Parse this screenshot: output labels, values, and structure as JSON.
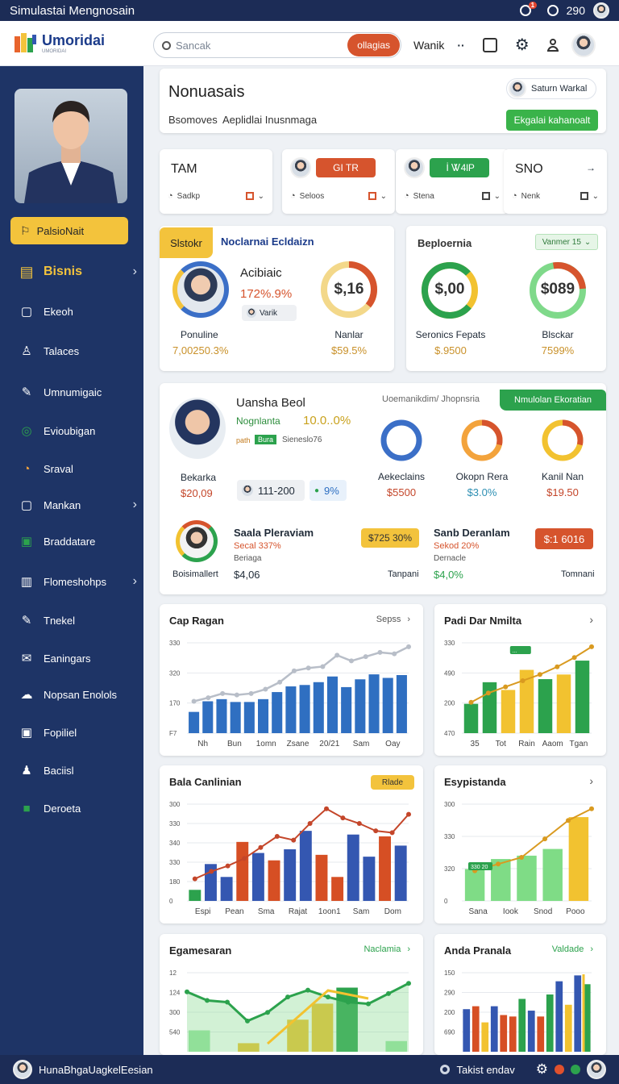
{
  "system": {
    "title": "Simulastai Mengnosain",
    "badge": "1",
    "time": "290"
  },
  "nav": {
    "brand": "Umoridai",
    "brand_sub": "UMORIDAI",
    "search_placeholder": "Sancak",
    "search_button": "ollagias",
    "user_menu": "Wanik",
    "more": "··"
  },
  "sidebar": {
    "primary_button": "PalsioNait",
    "items": [
      {
        "label": "Bisnis",
        "active": true,
        "chevron": "›"
      },
      {
        "label": "Ekeoh"
      },
      {
        "label": "Talaces"
      },
      {
        "label": "Umnumigaic"
      },
      {
        "label": "Evioubigan"
      },
      {
        "label": "Sraval"
      },
      {
        "label": "Mankan",
        "chevron": "›"
      },
      {
        "label": "Braddatare"
      },
      {
        "label": "Flomeshohps",
        "chevron": "›"
      },
      {
        "label": "Tnekel"
      },
      {
        "label": "Eaningars"
      },
      {
        "label": "Nopsan Enolols"
      },
      {
        "label": "Fopiliel"
      },
      {
        "label": "Baciisl"
      },
      {
        "label": "Deroeta"
      }
    ]
  },
  "header": {
    "title": "Nonuasais",
    "tab1": "Bsomoves",
    "tab2": "Aeplidlai Inusnmaga",
    "user_label": "Saturn Warkal",
    "action": "Ekgalai kahanoalt"
  },
  "filters": [
    {
      "title": "TAM",
      "field": "Sadkp"
    },
    {
      "title": "",
      "badge": "GI TR",
      "field": "Seloos"
    },
    {
      "title": "",
      "badge": " İ Ꮤ4lP",
      "field": "Stena"
    },
    {
      "title": "SNO",
      "field": "Nenk",
      "arrow": "→"
    }
  ],
  "summary_left": {
    "tag": "Slstokr",
    "title": "Noclarnai Ecldaizn",
    "person_name": "Acibiaic",
    "percent": "172%.9%",
    "chip": "Varik",
    "person_caption": "Ponuline",
    "person_value": "7,00250.3%",
    "ring_value": "$,16",
    "ring_label": "Nanlar",
    "ring_sub": "$59.5%"
  },
  "summary_right": {
    "title": "Beploernia",
    "dropdown": "Vanmer 15",
    "ring1_value": "$,00",
    "ring1_label": "Seronics Fepats",
    "ring1_sub": "$.9500",
    "ring2_value": "$089",
    "ring2_label": "Blsckar",
    "ring2_sub": "7599%"
  },
  "detail": {
    "name": "Uansha Beol",
    "subtitle": "Uoemanikdim/ Jhopnsria",
    "green_button": "Nmulolan Ekoratian",
    "line1_label": "Nognlanta",
    "line1_value": "10.0..0%",
    "tag1": "path",
    "tag2": "Bura",
    "tag3": "Sieneslo76",
    "person_caption": "Bekarka",
    "person_value": "$20,09",
    "pill1": "111-200",
    "pill2": "9%",
    "rings": [
      {
        "label": "Aekeclains",
        "value": "$5500"
      },
      {
        "label": "Okopn Rera",
        "value": "$3.0%"
      },
      {
        "label": "Kanil Nan",
        "value": "$19.50"
      }
    ],
    "row2_left": {
      "caption": "Boisimallert",
      "value": "$4,06",
      "name": "Saala Pleraviam",
      "sub": "Secal 337%",
      "sub2": "Beriaga",
      "badge": "$725 30%",
      "trail": "Tanpani"
    },
    "row2_right": {
      "name": "Sanb Deranlam",
      "sub": "Sekod 20%",
      "sub2": "Dernacle",
      "value": "$4,0%",
      "badge": "$:1 6016",
      "trail": "Tomnani"
    }
  },
  "chart_data": [
    {
      "type": "bar",
      "title": "Cap Ragan",
      "link": "Sepss",
      "categories": [
        "Nh",
        "Bun",
        "1omn",
        "Zsane",
        "20/21",
        "Sam",
        "Oay"
      ],
      "yticks": [
        "330",
        "320",
        "170",
        "F7"
      ],
      "values": [
        30,
        45,
        48,
        44,
        44,
        48,
        58,
        66,
        68,
        72,
        80,
        65,
        76,
        83,
        78,
        82
      ],
      "line": [
        45,
        50,
        56,
        54,
        56,
        62,
        72,
        88,
        92,
        94,
        110,
        102,
        108,
        114,
        112,
        122
      ]
    },
    {
      "type": "bar",
      "title": "Padi Dar Nmilta",
      "categories": [
        "35",
        "Tot",
        "Rain",
        "Aaom",
        "Tgan"
      ],
      "yticks": [
        "330",
        "490",
        "200",
        "470"
      ],
      "values": [
        38,
        66,
        56,
        82,
        70,
        76,
        94
      ],
      "colors": [
        "#2ca24d",
        "#2ca24d",
        "#f2c230",
        "#f2c230",
        "#2ca24d",
        "#f2c230",
        "#2ca24d"
      ],
      "line": [
        40,
        52,
        60,
        68,
        76,
        86,
        98,
        112
      ],
      "badge": "..."
    },
    {
      "type": "bar",
      "title": "Bala Canlinian",
      "badge": "Rlade",
      "categories": [
        "Espi",
        "Pean",
        "Sma",
        "Rajat",
        "1oon1",
        "Sam",
        "Dom"
      ],
      "yticks": [
        "300",
        "330",
        "340",
        "330",
        "180",
        "0"
      ],
      "values": [
        12,
        40,
        26,
        64,
        52,
        44,
        56,
        76,
        50,
        26,
        72,
        48,
        70,
        60
      ],
      "colors": [
        "#2ca24d",
        "#3457b1",
        "#3457b1",
        "#d64f24",
        "#3457b1",
        "#d64f24",
        "#3457b1",
        "#3457b1",
        "#d64f24",
        "#d64f24",
        "#3457b1",
        "#3457b1",
        "#d64f24",
        "#3457b1"
      ],
      "line": [
        24,
        32,
        38,
        46,
        58,
        70,
        66,
        84,
        100,
        90,
        84,
        76,
        74,
        94
      ]
    },
    {
      "type": "bar",
      "title": "Esypistanda",
      "categories": [
        "Sana",
        "Iook",
        "Snod",
        "Pooo"
      ],
      "yticks": [
        "300",
        "330",
        "320",
        "0"
      ],
      "values": [
        38,
        50,
        54,
        62,
        100
      ],
      "colors": [
        "#7fdc86",
        "#7fdc86",
        "#7fdc86",
        "#7fdc86",
        "#f2c230"
      ],
      "line": [
        36,
        44,
        52,
        74,
        96,
        110
      ],
      "badge": "330 20"
    },
    {
      "type": "area",
      "title": "Egamesaran",
      "link": "Naclamia",
      "yticks": [
        "12",
        "124",
        "300",
        "540"
      ],
      "values": [
        70,
        60,
        58,
        36,
        46,
        64,
        72,
        64,
        58,
        56,
        68,
        80
      ],
      "bars": [
        20,
        0,
        8,
        0,
        30,
        45,
        60,
        0,
        10
      ],
      "colors": [
        "#9be5a3",
        "#9be5a3",
        "#f2c230",
        "#9be5a3",
        "#f2c230",
        "#f2c230",
        "#2ca24d",
        "#f2c230",
        "#9be5a3"
      ]
    },
    {
      "type": "bar",
      "title": "Anda Pranala",
      "link": "Valdade",
      "yticks": [
        "150",
        "290",
        "200",
        "690"
      ],
      "values": [
        58,
        62,
        40,
        62,
        50,
        48,
        72,
        56,
        48,
        78,
        96,
        64,
        104,
        92
      ],
      "colors": [
        "#3457b1",
        "#d64f24",
        "#f2c230",
        "#3457b1",
        "#d64f24",
        "#d64f24",
        "#2ca24d",
        "#3457b1",
        "#d64f24",
        "#2ca24d",
        "#3457b1",
        "#f2c230",
        "#3457b1",
        "#2ca24d"
      ]
    }
  ],
  "bottom": {
    "user": "HunaBhgaUagkelEesian",
    "status": "Takist endav"
  }
}
